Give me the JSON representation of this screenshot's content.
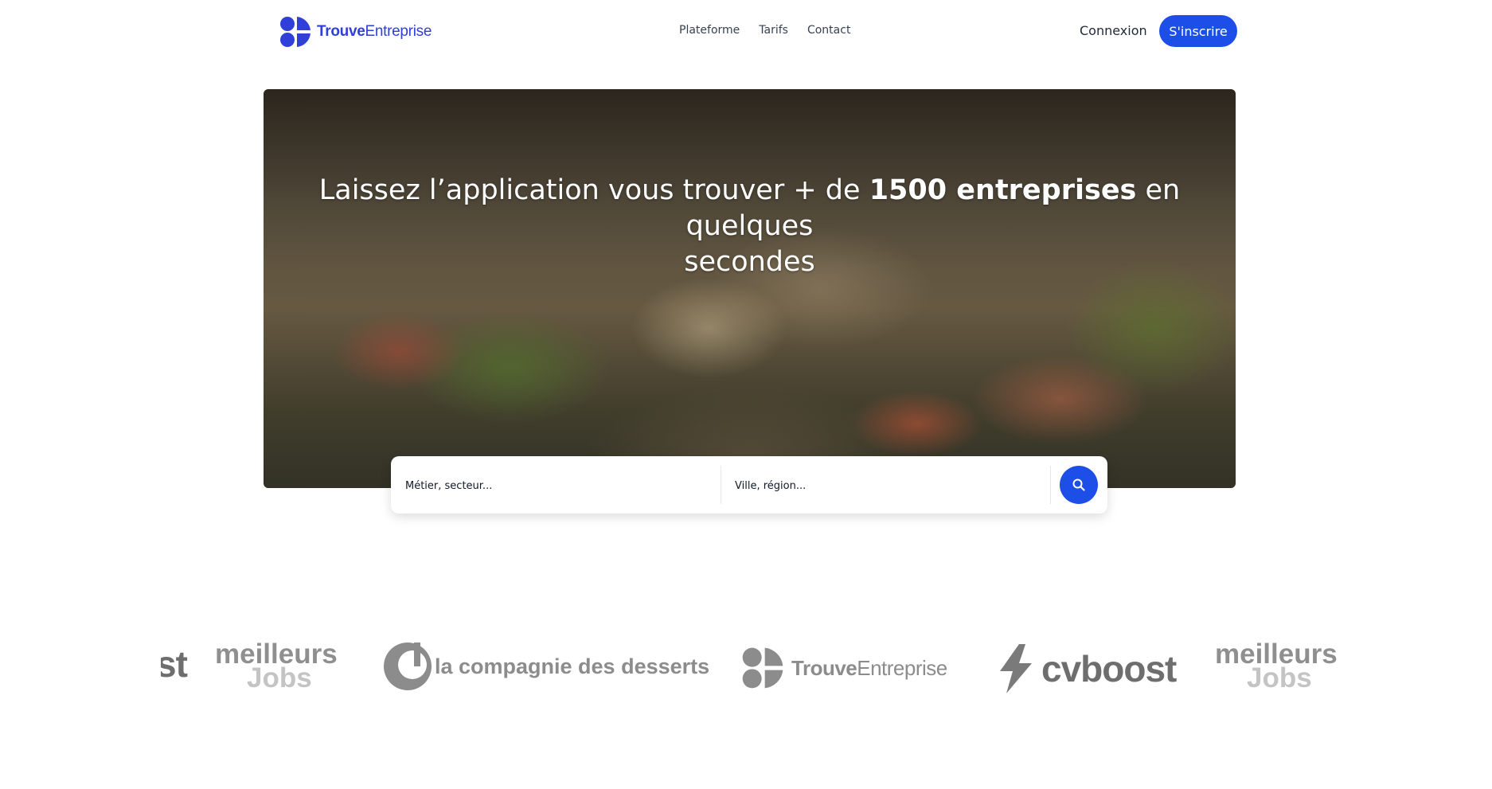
{
  "header": {
    "brand_bold": "Trouve",
    "brand_light": "Entreprise",
    "nav": [
      "Plateforme",
      "Tarifs",
      "Contact"
    ],
    "login_label": "Connexion",
    "signup_label": "S'inscrire"
  },
  "hero": {
    "title_pre": "Laissez l’application vous trouver + de ",
    "title_bold": "1500 entreprises",
    "title_post": " en quelques",
    "title_line2": "secondes"
  },
  "search": {
    "job_placeholder": "Métier, secteur...",
    "location_placeholder": "Ville, région...",
    "button_icon": "search-icon"
  },
  "partners": {
    "partial_text": "st",
    "meilleurs_top": "meilleurs",
    "meilleurs_bottom": "Jobs",
    "desserts": "la compagnie des desserts",
    "te_bold": "Trouve",
    "te_light": "Entreprise",
    "cvboost": "cvboost"
  },
  "colors": {
    "accent": "#1d4fe8",
    "brand": "#2f3fd8",
    "logo_gray": "#8c8c8c"
  }
}
